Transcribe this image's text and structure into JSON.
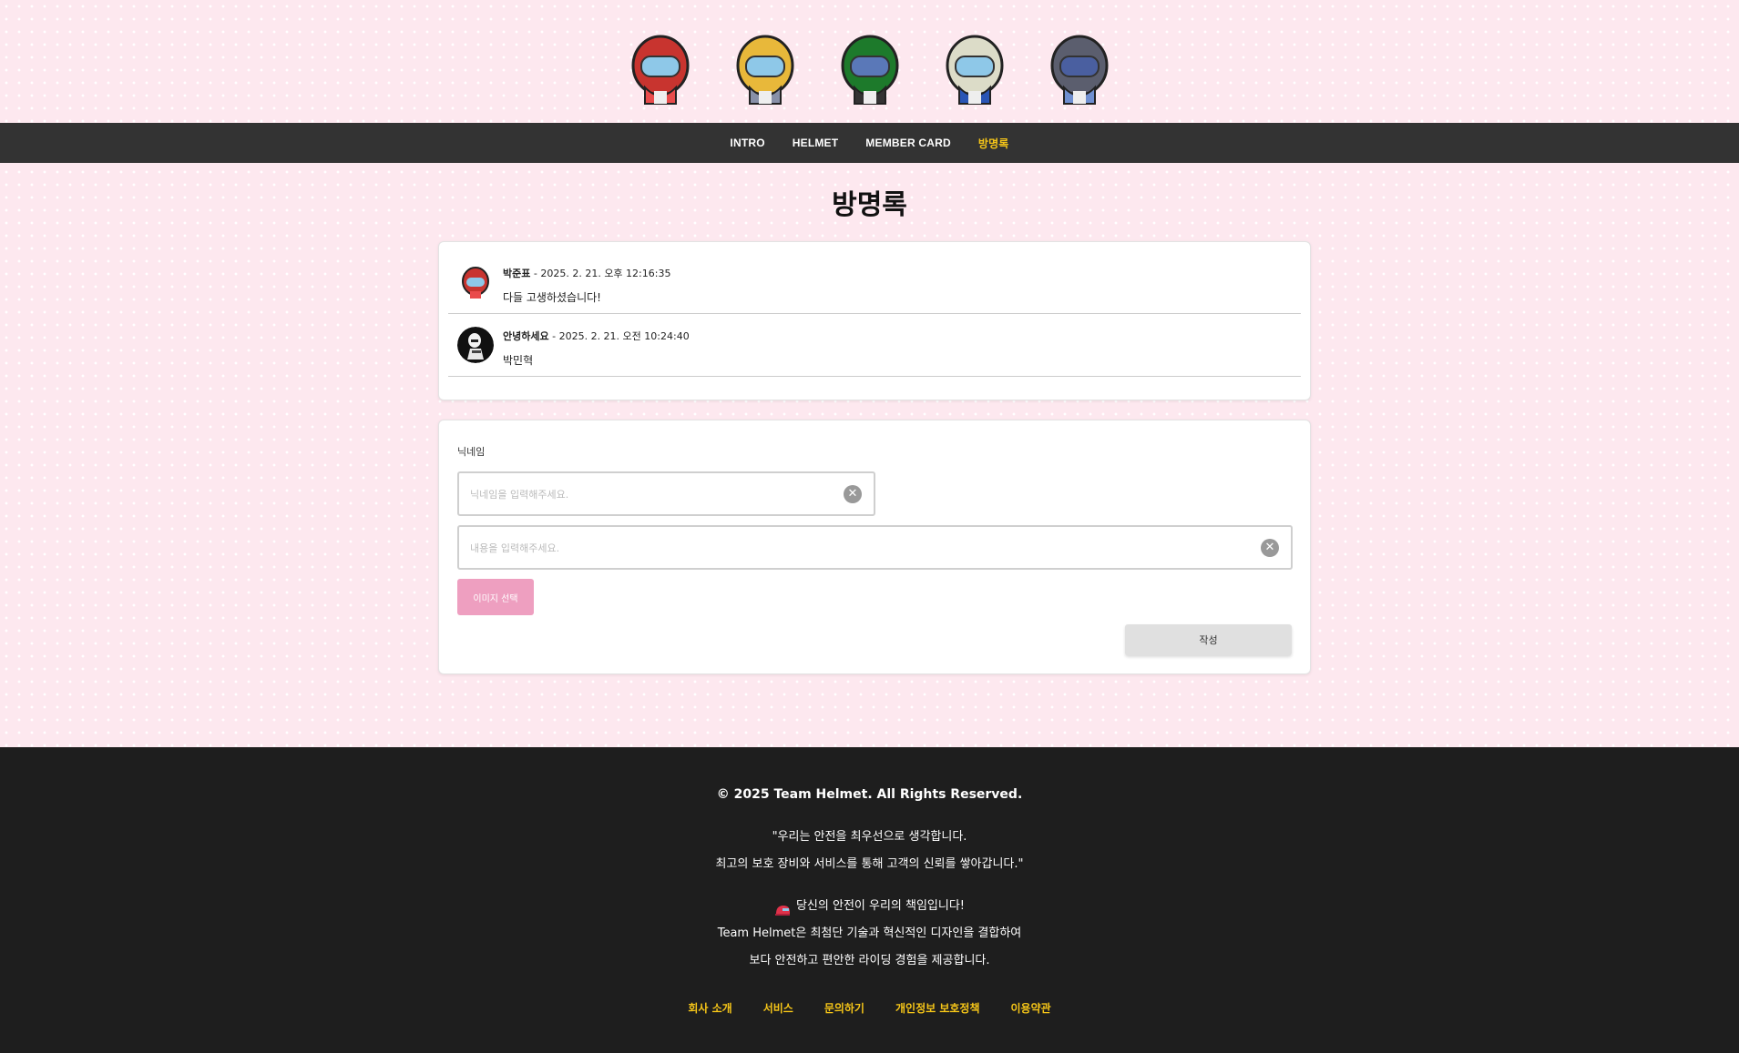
{
  "helmets": [
    {
      "name": "red",
      "color": "#c8342f"
    },
    {
      "name": "yellow",
      "color": "#e8b83a"
    },
    {
      "name": "green",
      "color": "#1d7a2b"
    },
    {
      "name": "white",
      "color": "#dcdcc8"
    },
    {
      "name": "gray",
      "color": "#5b5e6e"
    }
  ],
  "nav": {
    "items": [
      "INTRO",
      "HELMET",
      "MEMBER CARD",
      "방명록"
    ],
    "active_index": 3,
    "active_color": "#f5c518"
  },
  "page_title": "방명록",
  "entries": [
    {
      "author": "박준표",
      "timestamp": "2025. 2. 21. 오후 12:16:35",
      "message": "다들 고생하셨습니다!",
      "avatar": "red-helmet"
    },
    {
      "author": "안녕하세요",
      "timestamp": "2025. 2. 21. 오전 10:24:40",
      "message": "박민혁",
      "avatar": "stormtrooper"
    }
  ],
  "form": {
    "label": "닉네임",
    "nickname_placeholder": "닉네임을 입력해주세요.",
    "content_placeholder": "내용을 입력해주세요.",
    "image_button": "이미지 선택",
    "submit_button": "작성"
  },
  "footer": {
    "copyright": "© 2025 Team Helmet. All Rights Reserved.",
    "quote_line1": "\"우리는 안전을 최우선으로 생각합니다.",
    "quote_line2": "최고의 보호 장비와 서비스를 통해 고객의 신뢰를 쌓아갑니다.\"",
    "safety_line1": "당신의 안전이 우리의 책임입니다!",
    "safety_line2": "Team Helmet은 최첨단 기술과 혁신적인 디자인을 결합하여",
    "safety_line3": "보다 안전하고 편안한 라이딩 경험을 제공합니다.",
    "links": [
      "회사 소개",
      "서비스",
      "문의하기",
      "개인정보 보호정책",
      "이용약관"
    ],
    "link_color": "#f5c518",
    "background": "#1e1e1e"
  }
}
